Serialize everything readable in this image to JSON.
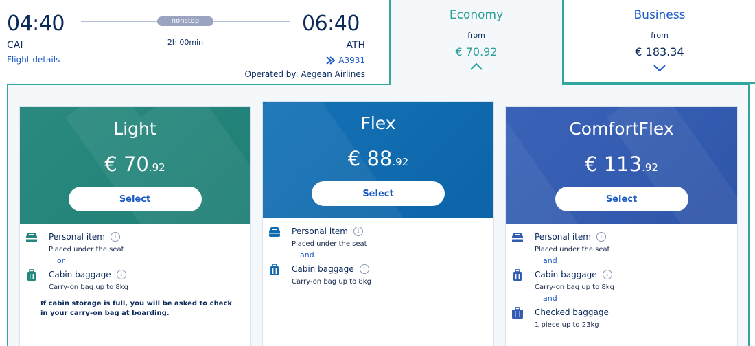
{
  "flight": {
    "dep_time": "04:40",
    "arr_time": "06:40",
    "dep_code": "CAI",
    "arr_code": "ATH",
    "stop_badge": "nonstop",
    "duration": "2h 00min",
    "flight_details_label": "Flight details",
    "flight_number": "A3931",
    "operated_by": "Operated by: Aegean Airlines"
  },
  "cabins": {
    "economy": {
      "name": "Economy",
      "from_label": "from",
      "price": "€ 70.92",
      "expanded": true
    },
    "business": {
      "name": "Business",
      "from_label": "from",
      "price": "€ 183.34",
      "expanded": false
    }
  },
  "fares": [
    {
      "name": "Light",
      "price_main": "€ 70",
      "price_cents": ".92",
      "select_label": "Select",
      "color": "#22867c",
      "features": [
        {
          "title": "Personal item",
          "desc": "Placed under the seat",
          "icon": "briefcase-icon"
        },
        {
          "connector": "or"
        },
        {
          "title": "Cabin baggage",
          "desc": "Carry-on bag up to 8kg",
          "icon": "suitcase-icon"
        }
      ],
      "note": "If cabin storage is full, you will be asked to check in your carry-on bag at boarding."
    },
    {
      "name": "Flex",
      "price_main": "€ 88",
      "price_cents": ".92",
      "select_label": "Select",
      "color": "#106bb0",
      "features": [
        {
          "title": "Personal item",
          "desc": "Placed under the seat",
          "icon": "briefcase-icon"
        },
        {
          "connector": "and"
        },
        {
          "title": "Cabin baggage",
          "desc": "Carry-on bag up to 8kg",
          "icon": "suitcase-icon"
        }
      ]
    },
    {
      "name": "ComfortFlex",
      "price_main": "€ 113",
      "price_cents": ".92",
      "select_label": "Select",
      "color": "#345cb0",
      "features": [
        {
          "title": "Personal item",
          "desc": "Placed under the seat",
          "icon": "briefcase-icon"
        },
        {
          "connector": "and"
        },
        {
          "title": "Cabin baggage",
          "desc": "Carry-on bag up to 8kg",
          "icon": "suitcase-icon"
        },
        {
          "connector": "and"
        },
        {
          "title": "Checked baggage",
          "desc": "1 piece up to 23kg",
          "icon": "checked-bag-icon"
        }
      ]
    }
  ]
}
